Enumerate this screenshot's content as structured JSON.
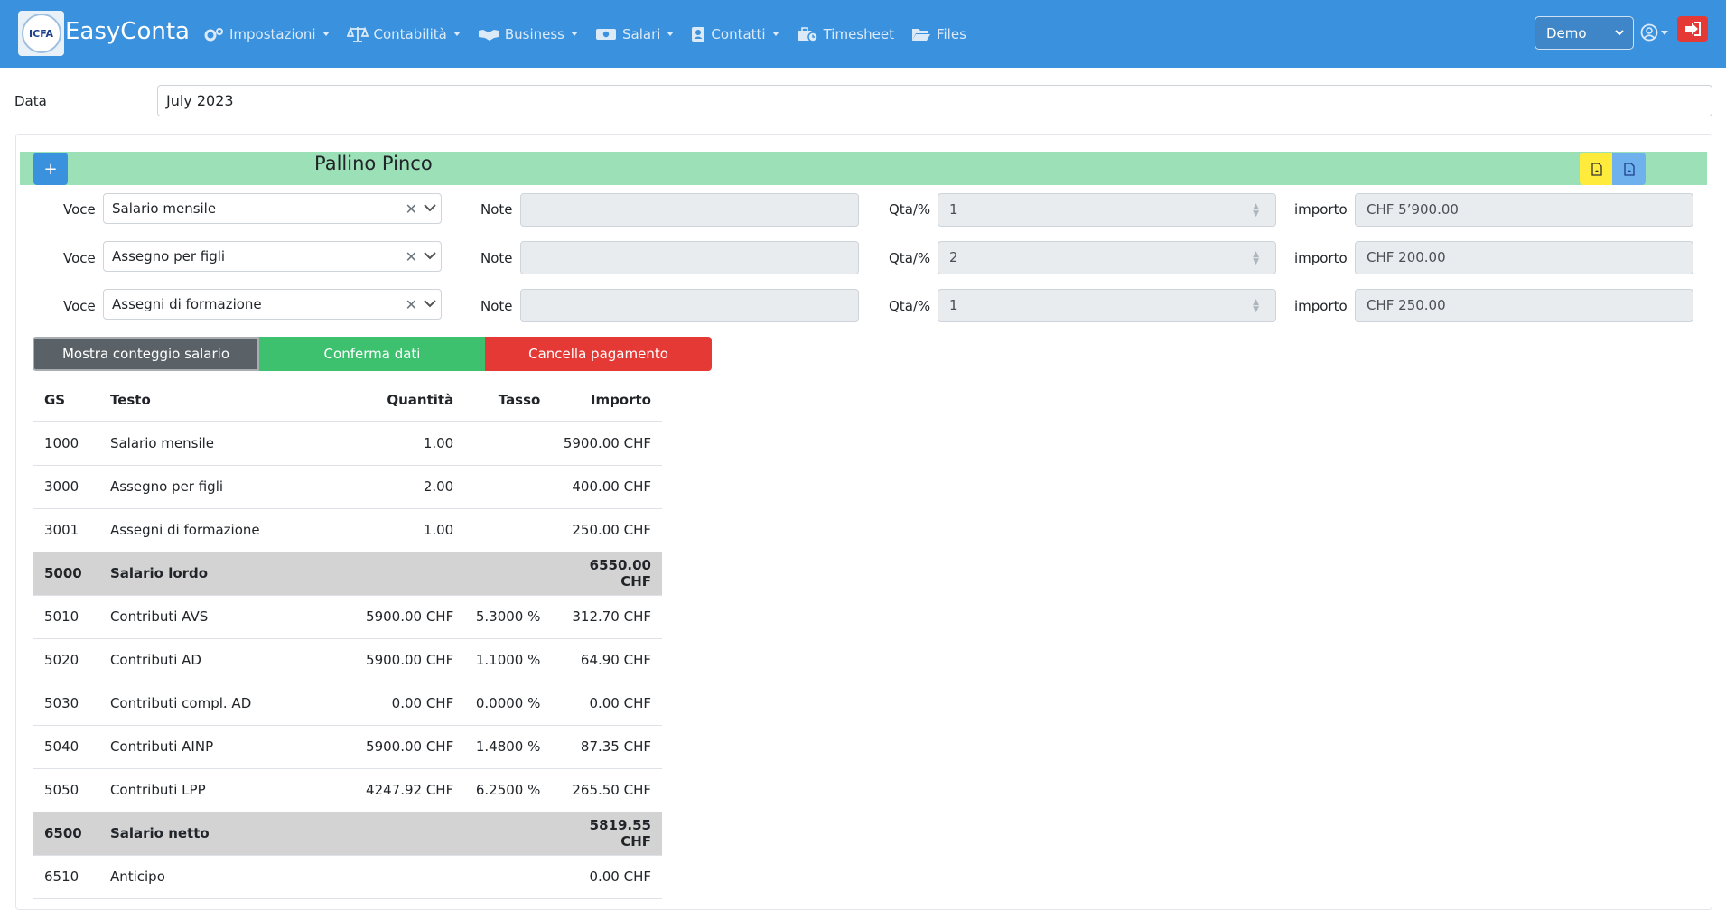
{
  "navbar": {
    "logo_text": "ICFA",
    "brand": "EasyConta",
    "menu": [
      {
        "label": "Impostazioni",
        "icon": "gears-icon",
        "dropdown": true
      },
      {
        "label": "Contabilità",
        "icon": "balance-scale-icon",
        "dropdown": true
      },
      {
        "label": "Business",
        "icon": "handshake-icon",
        "dropdown": true
      },
      {
        "label": "Salari",
        "icon": "money-bill-icon",
        "dropdown": true
      },
      {
        "label": "Contatti",
        "icon": "address-book-icon",
        "dropdown": true
      },
      {
        "label": "Timesheet",
        "icon": "business-time-icon",
        "dropdown": false
      },
      {
        "label": "Files",
        "icon": "folder-open-icon",
        "dropdown": false
      }
    ],
    "company_select": "Demo",
    "colors": {
      "bar": "#3a91de",
      "logout": "#e53935"
    }
  },
  "date": {
    "label": "Data",
    "value": "July 2023"
  },
  "employee": {
    "add_label": "+",
    "name": "Pallino Pinco",
    "rows": [
      {
        "voce_label": "Voce",
        "voce": "Salario mensile",
        "note_label": "Note",
        "note": "",
        "qta_label": "Qta/%",
        "qta": "1",
        "importo_label": "importo",
        "importo": "CHF 5’900.00"
      },
      {
        "voce_label": "Voce",
        "voce": "Assegno per figli",
        "note_label": "Note",
        "note": "",
        "qta_label": "Qta/%",
        "qta": "2",
        "importo_label": "importo",
        "importo": "CHF 200.00"
      },
      {
        "voce_label": "Voce",
        "voce": "Assegni di formazione",
        "note_label": "Note",
        "note": "",
        "qta_label": "Qta/%",
        "qta": "1",
        "importo_label": "importo",
        "importo": "CHF 250.00"
      }
    ]
  },
  "actions": {
    "show": "Mostra conteggio salario",
    "confirm": "Conferma dati",
    "cancel": "Cancella pagamento"
  },
  "table": {
    "headers": [
      "GS",
      "Testo",
      "Quantità",
      "Tasso",
      "Importo"
    ],
    "rows": [
      {
        "gs": "1000",
        "testo": "Salario mensile",
        "qta": "1.00",
        "tasso": "",
        "importo": "5900.00 CHF",
        "subtotal": false
      },
      {
        "gs": "3000",
        "testo": "Assegno per figli",
        "qta": "2.00",
        "tasso": "",
        "importo": "400.00 CHF",
        "subtotal": false
      },
      {
        "gs": "3001",
        "testo": "Assegni di formazione",
        "qta": "1.00",
        "tasso": "",
        "importo": "250.00 CHF",
        "subtotal": false
      },
      {
        "gs": "5000",
        "testo": "Salario lordo",
        "qta": "",
        "tasso": "",
        "importo": "6550.00 CHF",
        "subtotal": true
      },
      {
        "gs": "5010",
        "testo": "Contributi AVS",
        "qta": "5900.00 CHF",
        "tasso": "5.3000 %",
        "importo": "312.70 CHF",
        "subtotal": false
      },
      {
        "gs": "5020",
        "testo": "Contributi AD",
        "qta": "5900.00 CHF",
        "tasso": "1.1000 %",
        "importo": "64.90 CHF",
        "subtotal": false
      },
      {
        "gs": "5030",
        "testo": "Contributi compl. AD",
        "qta": "0.00 CHF",
        "tasso": "0.0000 %",
        "importo": "0.00 CHF",
        "subtotal": false
      },
      {
        "gs": "5040",
        "testo": "Contributi AINP",
        "qta": "5900.00 CHF",
        "tasso": "1.4800 %",
        "importo": "87.35 CHF",
        "subtotal": false
      },
      {
        "gs": "5050",
        "testo": "Contributi LPP",
        "qta": "4247.92 CHF",
        "tasso": "6.2500 %",
        "importo": "265.50 CHF",
        "subtotal": false
      },
      {
        "gs": "6500",
        "testo": "Salario netto",
        "qta": "",
        "tasso": "",
        "importo": "5819.55 CHF",
        "subtotal": true
      },
      {
        "gs": "6510",
        "testo": "Anticipo",
        "qta": "",
        "tasso": "",
        "importo": "0.00 CHF",
        "subtotal": false
      }
    ]
  }
}
